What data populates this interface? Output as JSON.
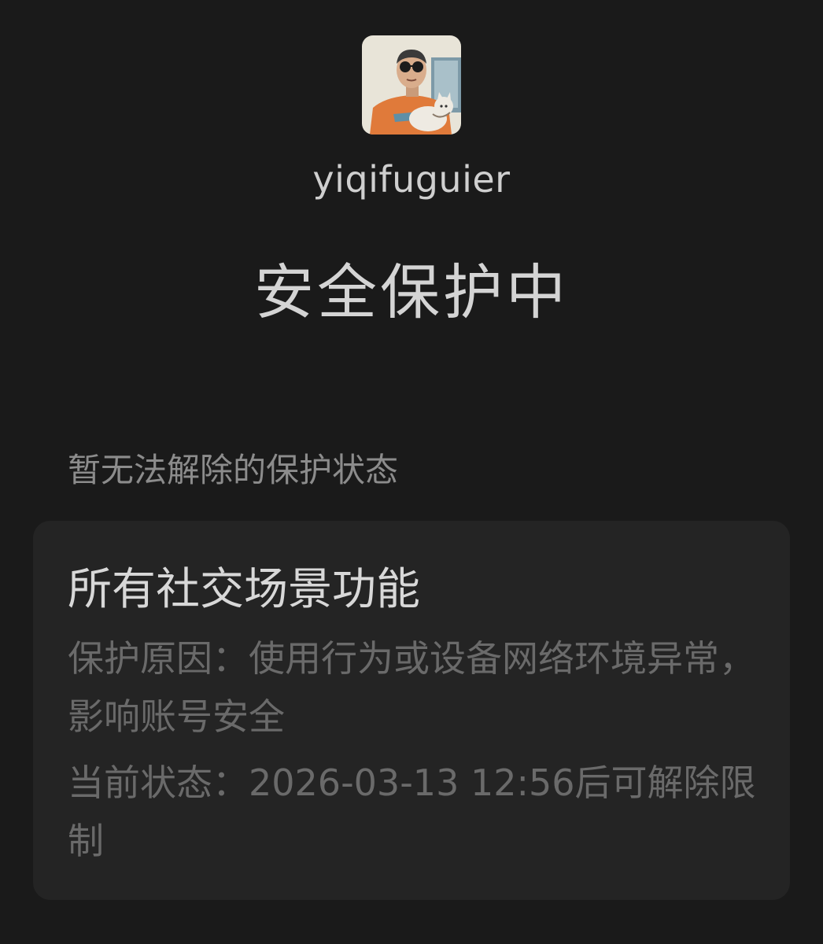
{
  "profile": {
    "avatar_icon": "user-avatar-illustration",
    "username": "yiqifuguier"
  },
  "title": "安全保护中",
  "section_label": "暂无法解除的保护状态",
  "card": {
    "title": "所有社交场景功能",
    "reason": "保护原因：使用行为或设备网络环境异常，影响账号安全",
    "status": "当前状态：2026-03-13 12:56后可解除限制"
  },
  "colors": {
    "background": "#1a1a1a",
    "card": "#242424",
    "title": "#d4d4d4",
    "muted": "#6a6a6a"
  }
}
